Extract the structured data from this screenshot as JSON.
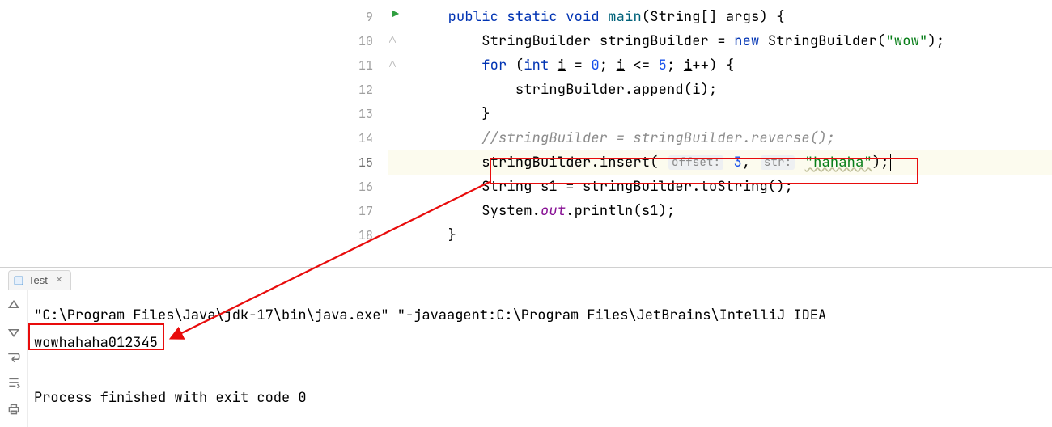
{
  "editor": {
    "lines": [
      {
        "n": 9,
        "run": true
      },
      {
        "n": 10
      },
      {
        "n": 11
      },
      {
        "n": 12
      },
      {
        "n": 13
      },
      {
        "n": 14
      },
      {
        "n": 15,
        "current": true
      },
      {
        "n": 16
      },
      {
        "n": 17
      },
      {
        "n": 18
      }
    ],
    "kw": {
      "public": "public",
      "static": "static",
      "void": "void",
      "new": "new",
      "for": "for",
      "int": "int"
    },
    "t": {
      "String": "String",
      "StringBuilder": "StringBuilder",
      "System": "System"
    },
    "id": {
      "main": "main",
      "args": "args",
      "stringBuilder": "stringBuilder",
      "append": "append",
      "insert": "insert",
      "toString": "toString",
      "println": "println",
      "reverse": "reverse",
      "i": "i",
      "s1": "s1",
      "out": "out"
    },
    "lit": {
      "wow": "\"wow\"",
      "hahaha": "\"hahaha\"",
      "zero": "0",
      "five": "5",
      "three": "3"
    },
    "hints": {
      "offset": "offset:",
      "str": "str:"
    },
    "cmt14": "//stringBuilder = stringBuilder.reverse();",
    "p": {
      "sqlb": "[",
      "sqrb": "]",
      "lp": "(",
      "rp": ")",
      "lb": "{",
      "rb": "}",
      "semi": ";",
      "eq": " = ",
      "dot": ".",
      "comma": ", ",
      "sp": " ",
      "leq": " <= ",
      "pp": "++",
      "assign": " = "
    }
  },
  "run": {
    "tab_label": "Test",
    "line1": "\"C:\\Program Files\\Java\\jdk-17\\bin\\java.exe\" \"-javaagent:C:\\Program Files\\JetBrains\\IntelliJ IDEA",
    "output": "wowhahaha012345",
    "finished": "Process finished with exit code 0"
  }
}
